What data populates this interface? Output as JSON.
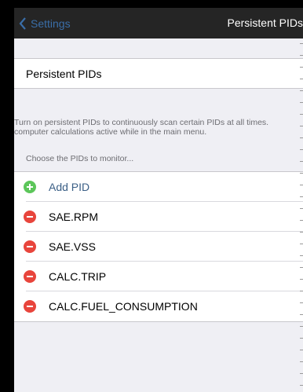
{
  "nav": {
    "back_label": "Settings",
    "title": "Persistent PIDs"
  },
  "toggle_row": {
    "label": "Persistent PIDs"
  },
  "description": "Turn on persistent PIDs to continuously scan certain PIDs at all times. computer calculations active while in the main menu.",
  "choose_label": "Choose the PIDs to monitor...",
  "add_pid_label": "Add PID",
  "pids": [
    {
      "label": "SAE.RPM"
    },
    {
      "label": "SAE.VSS"
    },
    {
      "label": "CALC.TRIP"
    },
    {
      "label": "CALC.FUEL_CONSUMPTION"
    }
  ],
  "colors": {
    "nav_background": "#252525",
    "back_link": "#3a6ea8",
    "add_green": "#5cc65a",
    "delete_red": "#e8453c",
    "add_label": "#3b5f86"
  }
}
